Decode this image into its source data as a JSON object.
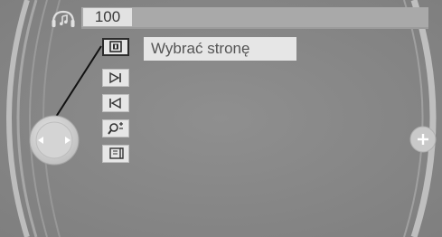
{
  "header": {
    "counter_value": "100",
    "source_icon": "headphone-note-icon"
  },
  "menu": {
    "items": [
      {
        "icon": "select-page-icon",
        "selected": true
      },
      {
        "icon": "next-track-icon",
        "selected": false
      },
      {
        "icon": "previous-track-icon",
        "selected": false
      },
      {
        "icon": "search-icon",
        "selected": false
      },
      {
        "icon": "book-page-icon",
        "selected": false
      }
    ]
  },
  "tooltip": {
    "label": "Wybrać stronę"
  },
  "controls": {
    "plus_icon": "plus-icon",
    "controller_icon": "controller-arrows-icon"
  }
}
